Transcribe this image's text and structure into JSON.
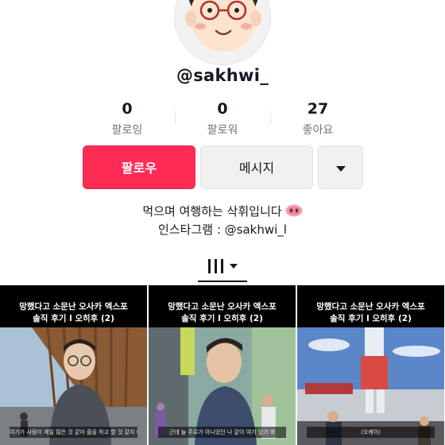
{
  "profile": {
    "username": "@sakhwi_",
    "avatar_icon": "cartoon-face-avatar"
  },
  "stats": [
    {
      "value": "0",
      "label": "팔로잉"
    },
    {
      "value": "0",
      "label": "팔로워"
    },
    {
      "value": "27",
      "label": "좋아요"
    }
  ],
  "actions": {
    "follow_label": "팔로우",
    "message_label": "메시지",
    "more_icon": "triangle-down-icon"
  },
  "bio": {
    "line1": "먹으며 여행하는 삭휘입니다",
    "line1_icon": "pig-nose-icon",
    "line2": "인스타그램 : @sakhwi_l"
  },
  "tab": {
    "icon": "videos-grid-icon",
    "dropdown_icon": "caret-down-icon"
  },
  "videos": [
    {
      "title_line1": "망했다고 소문난 오사카 엑스포",
      "title_line2": "솔직 후기 l 오히후 (2)",
      "subtitle": "여기가 사람이 제일 많은 것 같아 줄을 하고 할 것 같지 아"
    },
    {
      "title_line1": "망했다고 소문난 오사카 엑스포",
      "title_line2": "솔직 후기 l 오히후 (2)",
      "subtitle": "근데 늘 주로가 아니었던 나 같이 여기 있어 봐"
    },
    {
      "title_line1": "망했다고 소문난 오사카 엑스포",
      "title_line2": "솔직 후기 l 오히후 (2)",
      "subtitle": "(오케이)"
    }
  ],
  "colors": {
    "follow_button": "#fe2c55",
    "secondary_button": "#f1f1f2",
    "text_primary": "#161823",
    "text_secondary": "#737373"
  }
}
